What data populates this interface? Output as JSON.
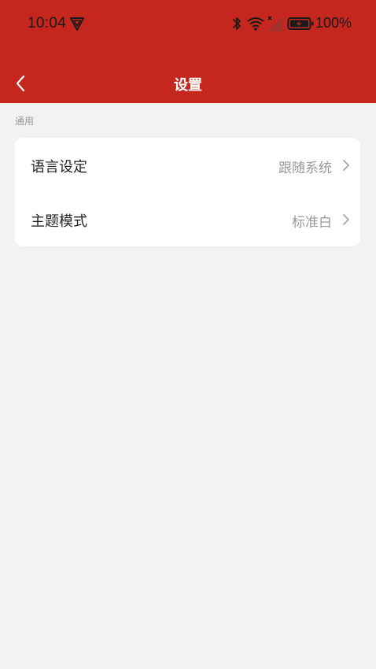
{
  "status_bar": {
    "time": "10:04",
    "battery": "100%"
  },
  "nav": {
    "title": "设置"
  },
  "section": {
    "label": "通用"
  },
  "settings": [
    {
      "label": "语言设定",
      "value": "跟随系统"
    },
    {
      "label": "主题模式",
      "value": "标准白"
    }
  ],
  "colors": {
    "brand": "#c5271e",
    "background": "#f2f2f2",
    "card": "#ffffff"
  },
  "icons": [
    "vpn-icon",
    "bluetooth-icon",
    "wifi-icon",
    "signal-icon",
    "battery-icon",
    "back-arrow-icon",
    "chevron-right-icon"
  ]
}
